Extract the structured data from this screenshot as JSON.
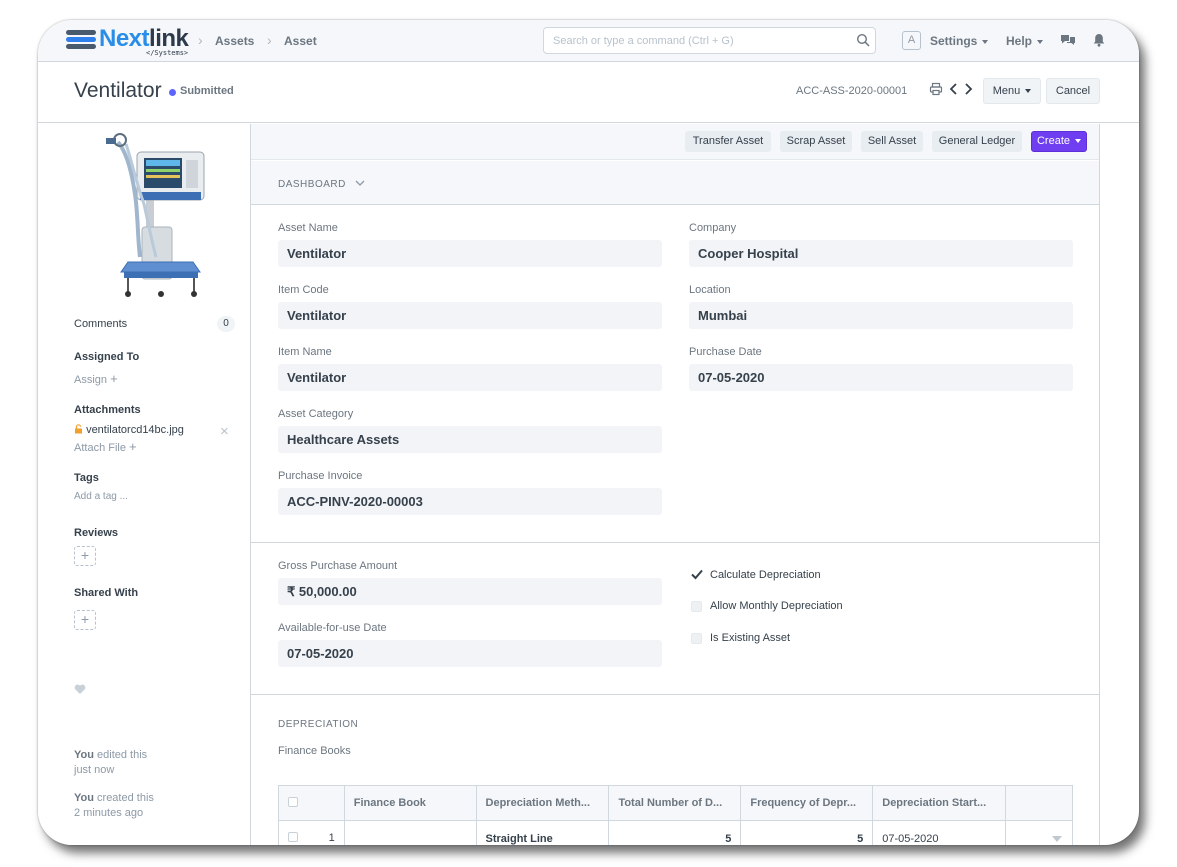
{
  "navbar": {
    "logo_main": "Next",
    "logo_accent": "link",
    "logo_sub": "</Systems>",
    "breadcrumbs": [
      "Assets",
      "Asset"
    ],
    "search_placeholder": "Search or type a command (Ctrl + G)",
    "avatar_letter": "A",
    "settings_label": "Settings",
    "help_label": "Help"
  },
  "page": {
    "title": "Ventilator",
    "status": "Submitted",
    "doc_id": "ACC-ASS-2020-00001",
    "menu_label": "Menu",
    "cancel_label": "Cancel"
  },
  "sidebar": {
    "comments_label": "Comments",
    "comments_count": "0",
    "assigned_to_label": "Assigned To",
    "assign_link": "Assign",
    "attachments_label": "Attachments",
    "attachment_file": "ventilatorcd14bc.jpg",
    "attach_file_link": "Attach File",
    "tags_label": "Tags",
    "add_tag_link": "Add a tag ...",
    "reviews_label": "Reviews",
    "shared_with_label": "Shared With",
    "activity": [
      {
        "actor": "You",
        "action": "edited this",
        "time": "just now"
      },
      {
        "actor": "You",
        "action": "created this",
        "time": "2 minutes ago"
      }
    ]
  },
  "actions": {
    "transfer": "Transfer Asset",
    "scrap": "Scrap Asset",
    "sell": "Sell Asset",
    "ledger": "General Ledger",
    "create": "Create"
  },
  "dashboard_label": "DASHBOARD",
  "fields": {
    "asset_name": {
      "label": "Asset Name",
      "value": "Ventilator"
    },
    "item_code": {
      "label": "Item Code",
      "value": "Ventilator"
    },
    "item_name": {
      "label": "Item Name",
      "value": "Ventilator"
    },
    "asset_category": {
      "label": "Asset Category",
      "value": "Healthcare Assets"
    },
    "purchase_invoice": {
      "label": "Purchase Invoice",
      "value": "ACC-PINV-2020-00003"
    },
    "company": {
      "label": "Company",
      "value": "Cooper Hospital"
    },
    "location": {
      "label": "Location",
      "value": "Mumbai"
    },
    "purchase_date": {
      "label": "Purchase Date",
      "value": "07-05-2020"
    },
    "gross_purchase_amount": {
      "label": "Gross Purchase Amount",
      "value": "₹ 50,000.00"
    },
    "available_for_use_date": {
      "label": "Available-for-use Date",
      "value": "07-05-2020"
    }
  },
  "checks": [
    {
      "label": "Calculate Depreciation",
      "checked": true
    },
    {
      "label": "Allow Monthly Depreciation",
      "checked": false
    },
    {
      "label": "Is Existing Asset",
      "checked": false
    }
  ],
  "depreciation": {
    "section_title": "DEPRECIATION",
    "finance_books_label": "Finance Books",
    "columns": [
      "Finance Book",
      "Depreciation Meth...",
      "Total Number of D...",
      "Frequency of Depr...",
      "Depreciation Start..."
    ],
    "rows": [
      {
        "idx": "1",
        "finance_book": "",
        "method": "Straight Line",
        "total": "5",
        "frequency": "5",
        "start": "07-05-2020"
      }
    ]
  }
}
